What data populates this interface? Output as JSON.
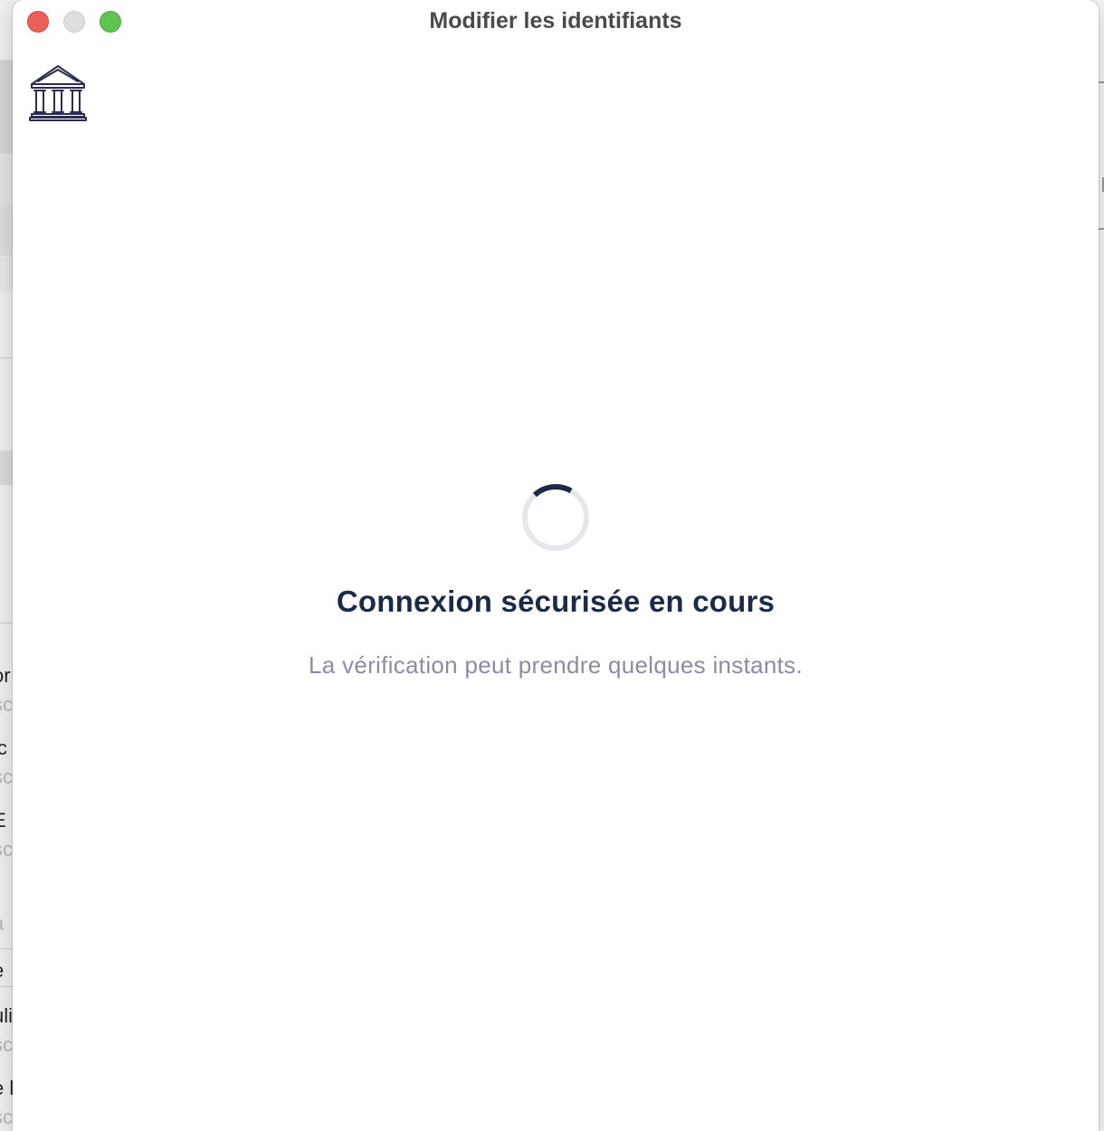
{
  "window": {
    "title": "Modifier les identifiants",
    "controls": {
      "close": "close-button",
      "minimize": "minimize-button",
      "zoom": "zoom-button"
    }
  },
  "logo": {
    "icon": "bank-building-icon",
    "color": "#2b2c4f"
  },
  "loading": {
    "spinner_icon": "loading-spinner-icon",
    "spinner_color": "#1b2a48",
    "spinner_track_color": "#e6e7ec",
    "heading": "Connexion sécurisée en cours",
    "message": "La vérification peut prendre quelques instants."
  },
  "background_app": {
    "fragments": [
      {
        "text": "or",
        "style": "main"
      },
      {
        "text": "sc",
        "style": "sub"
      },
      {
        "text": "ic",
        "style": "main"
      },
      {
        "text": "sc",
        "style": "sub"
      },
      {
        "text": "E",
        "style": "main"
      },
      {
        "text": "sc",
        "style": "sub"
      },
      {
        "text": "a",
        "style": "sub"
      },
      {
        "text": "e",
        "style": "main"
      },
      {
        "text": "uli",
        "style": "main"
      },
      {
        "text": "sc",
        "style": "sub"
      },
      {
        "text": "e l",
        "style": "main"
      },
      {
        "text": "sc",
        "style": "sub"
      }
    ]
  },
  "colors": {
    "accent": "#1b2a48",
    "muted_text": "#8b8ba3",
    "close": "#ec5f57",
    "minimize": "#dedede",
    "zoom": "#5fc454"
  }
}
